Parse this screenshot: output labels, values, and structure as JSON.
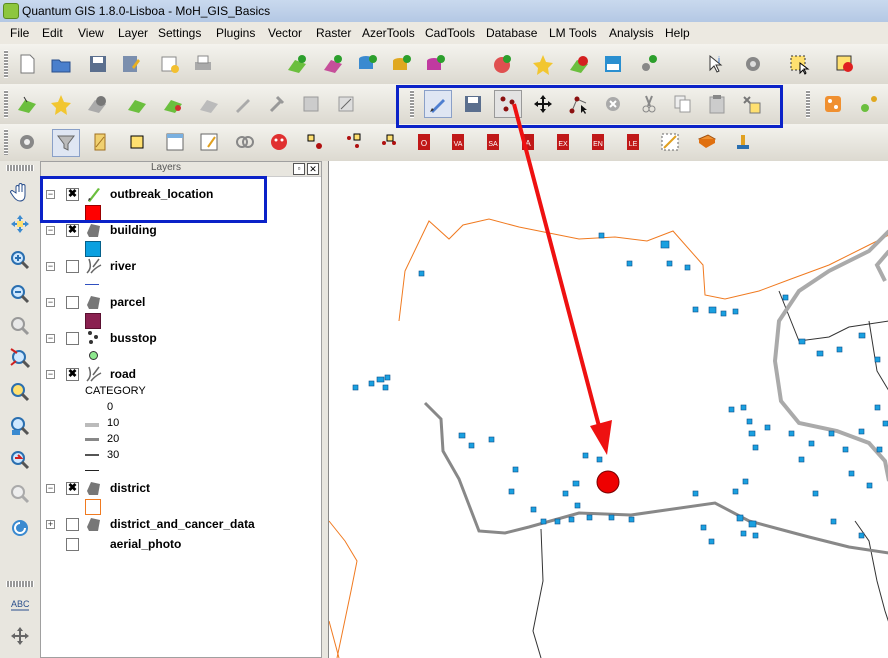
{
  "window": {
    "title": "Quantum GIS 1.8.0-Lisboa - MoH_GIS_Basics"
  },
  "menu": [
    "File",
    "Edit",
    "View",
    "Layer",
    "Settings",
    "Plugins",
    "Vector",
    "Raster",
    "AzerTools",
    "CadTools",
    "Database",
    "LM Tools",
    "Analysis",
    "Help"
  ],
  "toolbar1": {
    "icons": [
      "new-project-icon",
      "open-project-icon",
      "save-project-icon",
      "save-as-icon",
      "new-print-composer-icon",
      "print-icon",
      "add-vector-icon",
      "add-raster-icon",
      "add-postgis-icon",
      "add-spatialite-icon",
      "add-mssql-icon",
      "add-wms-icon",
      "add-wcs-icon",
      "remove-layer-icon",
      "add-delimited-text-icon",
      "add-gpx-icon",
      "identify-icon",
      "settings-gear-icon",
      "select-icon",
      "deselect-icon"
    ]
  },
  "toolbar2": {
    "icons": [
      "add-layer-icon",
      "favorite-star-icon",
      "remove-icon",
      "add-layer2-icon",
      "add-layer3-icon",
      "hide-icon",
      "pencil-tool-icon",
      "hammer-icon",
      "rotate-icon",
      "scale-icon",
      "toggle-editing-icon",
      "save-edits-icon",
      "add-feature-icon",
      "move-feature-icon",
      "node-tool-icon",
      "delete-selected-icon",
      "cut-features-icon",
      "copy-features-icon",
      "paste-features-icon",
      "attribute-editing-icon",
      "plugin-icon",
      "plugin2-icon"
    ]
  },
  "toolbar3": {
    "icons": [
      "gps-gear-icon",
      "filter-icon",
      "digitize-icon",
      "square-select-icon",
      "table-icon",
      "form-icon",
      "link-icon",
      "face-icon",
      "select-points-icon",
      "add-points-icon",
      "add-nodes-icon",
      "od-icon",
      "va-icon",
      "sa-icon",
      "a-icon",
      "ex-icon",
      "en-icon",
      "le-icon",
      "grid-ruler-icon",
      "book-icon",
      "stamp-icon"
    ],
    "labels": [
      "O",
      "VA",
      "SA",
      "A",
      "EX",
      "EN",
      "LE"
    ]
  },
  "left_tools": [
    "pan-icon",
    "pan-to-selection-icon",
    "zoom-in-icon",
    "zoom-out-icon",
    "zoom-full-icon",
    "zoom-to-selection-icon",
    "zoom-to-layer-icon",
    "zoom-actual-icon",
    "zoom-last-icon",
    "zoom-next-icon",
    "refresh-icon",
    "label-icon",
    "move-label-icon"
  ],
  "layers_panel": {
    "header": "Layers",
    "layers": [
      {
        "name": "outbreak_location",
        "checked": true,
        "swatch": "#ff0000"
      },
      {
        "name": "building",
        "checked": true,
        "swatch": "#0aa0e0"
      },
      {
        "name": "river",
        "checked": false
      },
      {
        "name": "parcel",
        "checked": false,
        "swatch": "#8a2050"
      },
      {
        "name": "busstop",
        "checked": false
      },
      {
        "name": "road",
        "checked": true
      },
      {
        "name": "district",
        "checked": true
      },
      {
        "name": "district_and_cancer_data",
        "checked": false
      },
      {
        "name": "aerial_photo",
        "checked": false
      }
    ],
    "road_legend": {
      "title": "CATEGORY",
      "classes": [
        "0",
        "10",
        "20",
        "30",
        ""
      ]
    }
  },
  "colors": {
    "highlight_box": "#0b22c8",
    "arrow": "#ee1111",
    "outbreak_point": "#ee0000",
    "district_line": "#f07a20",
    "road_line": "#8a8a8a",
    "building_fill": "#1aa0e0"
  }
}
